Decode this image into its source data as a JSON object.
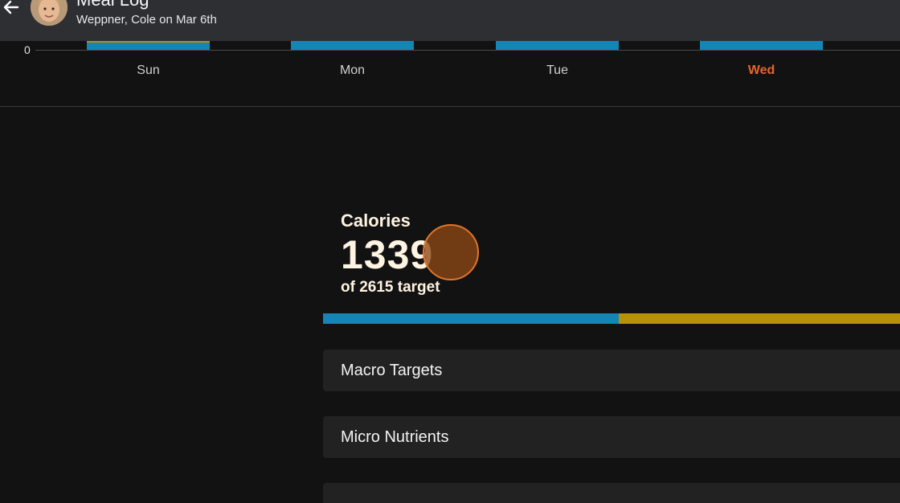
{
  "header": {
    "title": "Meal Log",
    "subtitle": "Weppner, Cole on Mar 6th"
  },
  "weekly_chart": {
    "y_zero_label": "0",
    "days": [
      {
        "label": "Sun",
        "active": false
      },
      {
        "label": "Mon",
        "active": false
      },
      {
        "label": "Tue",
        "active": false
      },
      {
        "label": "Wed",
        "active": true
      }
    ]
  },
  "calories": {
    "label": "Calories",
    "value": "1339",
    "target_text": "of 2615 target",
    "consumed": 1339,
    "target": 2615
  },
  "sections": [
    {
      "label": "Macro Targets"
    },
    {
      "label": "Micro Nutrients"
    },
    {
      "label": ""
    }
  ],
  "colors": {
    "accent_blue": "#1585b5",
    "accent_gold": "#b59207",
    "active_day": "#e8632a"
  }
}
